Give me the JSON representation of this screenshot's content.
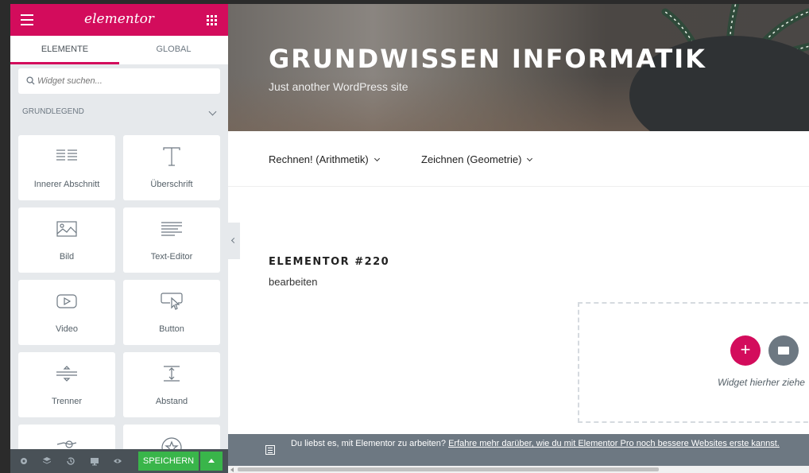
{
  "panel": {
    "logo": "elementor",
    "tabs": [
      {
        "label": "ELEMENTE",
        "active": true
      },
      {
        "label": "GLOBAL",
        "active": false
      }
    ],
    "search": {
      "placeholder": "Widget suchen..."
    },
    "section": {
      "title": "GRUNDLEGEND"
    },
    "widgets": [
      {
        "label": "Innerer Abschnitt",
        "icon": "inner-section-icon"
      },
      {
        "label": "Überschrift",
        "icon": "heading-icon"
      },
      {
        "label": "Bild",
        "icon": "image-icon"
      },
      {
        "label": "Text-Editor",
        "icon": "text-editor-icon"
      },
      {
        "label": "Video",
        "icon": "video-icon"
      },
      {
        "label": "Button",
        "icon": "button-icon"
      },
      {
        "label": "Trenner",
        "icon": "divider-icon"
      },
      {
        "label": "Abstand",
        "icon": "spacer-icon"
      },
      {
        "label": "",
        "icon": "google-maps-icon"
      },
      {
        "label": "",
        "icon": "star-icon"
      }
    ],
    "footer": {
      "save_label": "SPEICHERN",
      "icons": [
        "settings-icon",
        "navigator-icon",
        "history-icon",
        "responsive-icon",
        "preview-icon"
      ]
    }
  },
  "site": {
    "title": "GRUNDWISSEN INFORMATIK",
    "tagline": "Just another WordPress site",
    "nav": [
      {
        "label": "Rechnen! (Arithmetik)"
      },
      {
        "label": "Zeichnen (Geometrie)"
      }
    ],
    "post_title": "ELEMENTOR #220",
    "edit_link": "bearbeiten"
  },
  "dropzone": {
    "text": "Widget hierher ziehe"
  },
  "promo": {
    "text": "Du liebst es, mit Elementor zu arbeiten? ",
    "link": "Erfahre mehr darüber, wie du mit Elementor Pro noch bessere Websites erste kannst."
  },
  "colors": {
    "accent": "#d30c5c",
    "save": "#39b54a",
    "panel_bg": "#e6e9ec",
    "footer": "#495157"
  }
}
